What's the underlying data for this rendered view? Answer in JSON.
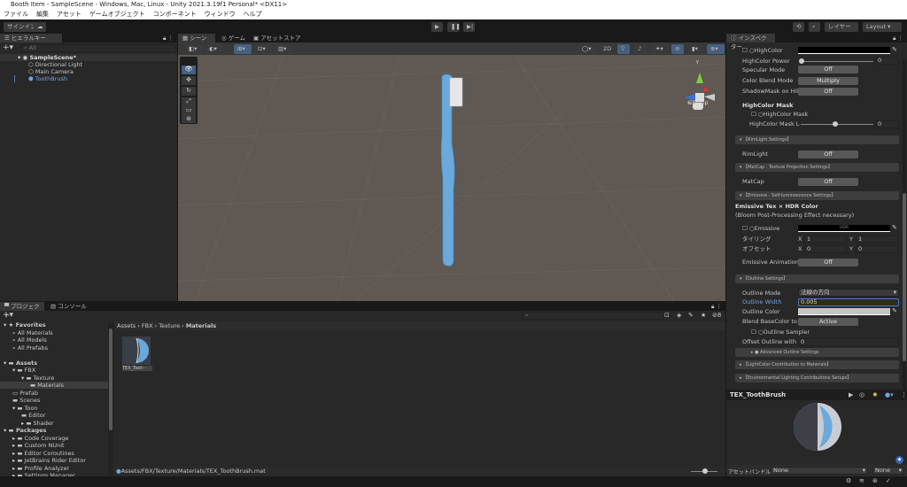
{
  "window": {
    "title": "Booth Item - SampleScene - Windows, Mac, Linux - Unity 2021.3.19f1 Personal* <DX11>"
  },
  "menu": [
    "ファイル",
    "編集",
    "アセット",
    "ゲームオブジェクト",
    "コンポーネント",
    "ウィンドウ",
    "ヘルプ"
  ],
  "toolbar": {
    "signin": "サインイン",
    "layers": "レイヤー",
    "layout": "Layout"
  },
  "hierarchy": {
    "tab": "ヒエラルキー",
    "search_placeholder": "All",
    "scene": "SampleScene*",
    "items": [
      "Directional Light",
      "Main Camera",
      "ToothBrush"
    ]
  },
  "scene": {
    "tabs": [
      "シーン",
      "ゲーム",
      "アセットストア"
    ],
    "mode_2d": "2D",
    "persp": "Persp",
    "gizmo_axis": "y"
  },
  "inspector": {
    "tab": "インスペクター",
    "highcolor": "HighColor",
    "highcolor_power": "HighColor Power",
    "highcolor_power_value": "0",
    "specular_mode": "Specular Mode",
    "specular_value": "Off",
    "color_blend_mode": "Color Blend Mode",
    "color_blend_value": "Multiply",
    "shadowmask": "ShadowMask on Hil",
    "shadowmask_value": "Off",
    "highcolor_mask_title": "HighColor Mask",
    "highcolor_mask": "HighColor Mask",
    "highcolor_mask_l": "HighColor Mask L",
    "highcolor_mask_l_value": "0",
    "rimlight_section": "【RimLight Settings】",
    "rimlight": "RimLight",
    "rimlight_value": "Off",
    "matcap_section": "【MatCap : Texture Projection Settings】",
    "matcap": "MatCap",
    "matcap_value": "Off",
    "emissive_section": "【Emissive : Self-luminescence Settings】",
    "emissive_title": "Emissive Tex × HDR Color",
    "emissive_note": "(Bloom Post-Processing Effect necessary)",
    "emissive": "Emissive",
    "hdr": "HDR",
    "tiling": "タイリング",
    "offset": "オフセット",
    "x": "X",
    "y": "Y",
    "tiling_x": "1",
    "tiling_y": "1",
    "offset_x": "0",
    "offset_y": "0",
    "emissive_animation": "Emissive Animation",
    "emissive_animation_value": "Off",
    "outline_section": "【Outline Settings】",
    "outline_mode": "Outline Mode",
    "outline_mode_value": "法線の方向",
    "outline_width": "Outline Width",
    "outline_width_value": "0.005",
    "outline_color": "Outline Color",
    "blend_basecolor": "Blend BaseColor to",
    "blend_basecolor_value": "Active",
    "outline_sampler": "Outline Sampler",
    "offset_outline": "Offset Outline with (",
    "offset_outline_value": "0",
    "advanced_outline": "● Advanced Outline Settings",
    "lightcolor_section": "【LightColor Contribution to Materials】",
    "env_section": "【Environmental Lighting Contributions Setups】"
  },
  "preview": {
    "title": "TEX_ToothBrush"
  },
  "assetbundle": {
    "label": "アセットバンドル",
    "name": "None",
    "variant": "None"
  },
  "project": {
    "tabs": [
      "プロジェクト",
      "コンソール"
    ],
    "tree": [
      {
        "label": "Favorites",
        "level": 0,
        "bold": true,
        "icon": "star"
      },
      {
        "label": "All Materials",
        "level": 1,
        "icon": "search"
      },
      {
        "label": "All Models",
        "level": 1,
        "icon": "search"
      },
      {
        "label": "All Prefabs",
        "level": 1,
        "icon": "search"
      },
      {
        "label": "",
        "level": 0,
        "icon": ""
      },
      {
        "label": "Assets",
        "level": 0,
        "bold": true,
        "icon": "folder"
      },
      {
        "label": "FBX",
        "level": 1,
        "icon": "folder"
      },
      {
        "label": "Texture",
        "level": 2,
        "icon": "folder"
      },
      {
        "label": "Materials",
        "level": 3,
        "icon": "folder",
        "selected": true
      },
      {
        "label": "Prefab",
        "level": 1,
        "icon": "folder-empty"
      },
      {
        "label": "Scenes",
        "level": 1,
        "icon": "folder"
      },
      {
        "label": "Toon",
        "level": 1,
        "icon": "folder"
      },
      {
        "label": "Editor",
        "level": 2,
        "icon": "folder"
      },
      {
        "label": "Shader",
        "level": 2,
        "icon": "folder"
      },
      {
        "label": "Packages",
        "level": 0,
        "bold": true,
        "icon": "folder"
      },
      {
        "label": "Code Coverage",
        "level": 1,
        "icon": "folder"
      },
      {
        "label": "Custom NUnit",
        "level": 1,
        "icon": "folder"
      },
      {
        "label": "Editor Coroutines",
        "level": 1,
        "icon": "folder"
      },
      {
        "label": "JetBrains Rider Editor",
        "level": 1,
        "icon": "folder"
      },
      {
        "label": "Profile Analyzer",
        "level": 1,
        "icon": "folder"
      },
      {
        "label": "Settings Manager",
        "level": 1,
        "icon": "folder"
      }
    ],
    "breadcrumb": [
      "Assets",
      "FBX",
      "Texture",
      "Materials"
    ],
    "asset_label": "TEX_Toot···",
    "path": "Assets/FBX/Texture/Materials/TEX_ToothBrush.mat",
    "hidden_count": "8"
  },
  "colors": {
    "accent": "#4c7bbf",
    "toothbrush": "#6aa9dc",
    "viewport": "#5f5853"
  }
}
